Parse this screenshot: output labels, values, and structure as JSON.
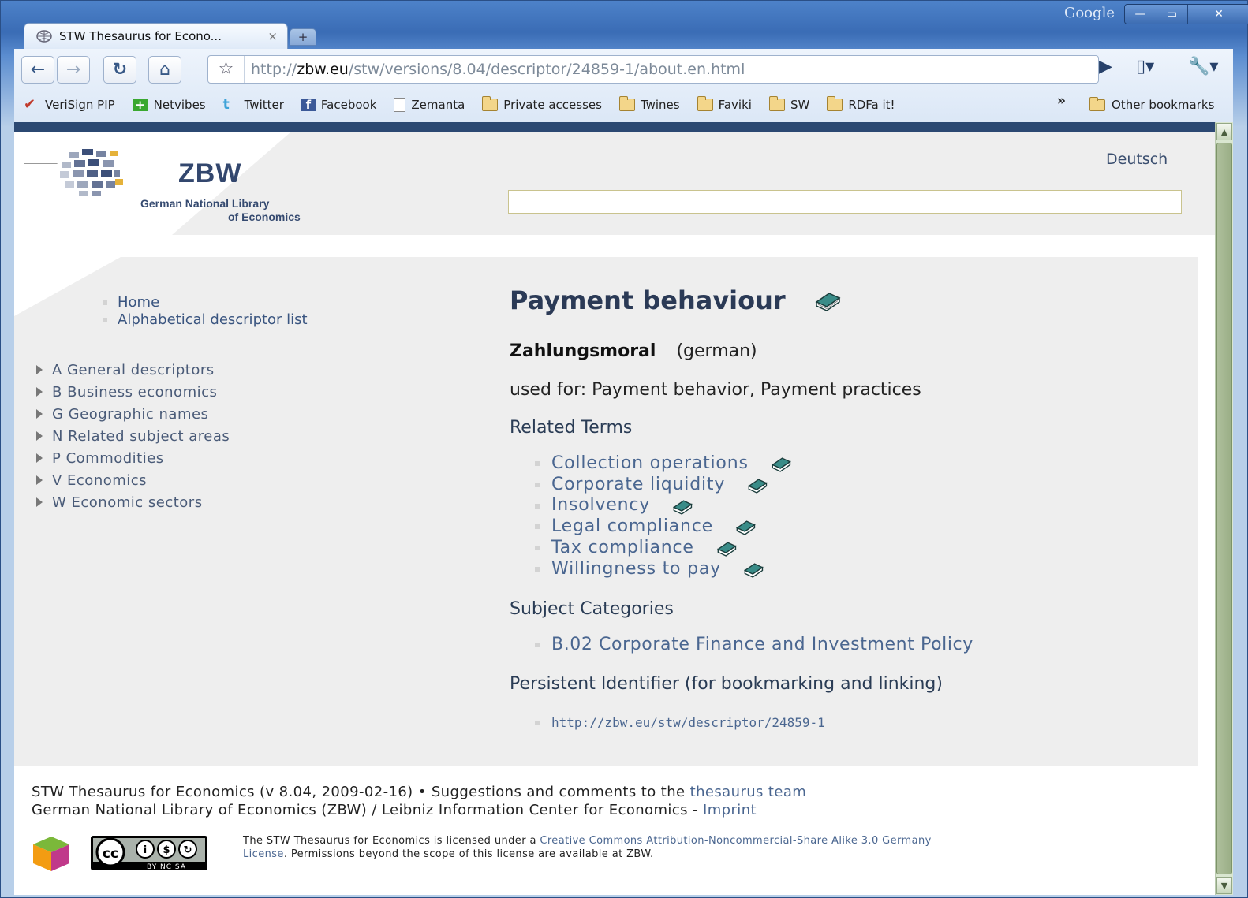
{
  "browser": {
    "brand": "Google",
    "tab_title": "STW Thesaurus for Econo...",
    "tab_close": "×",
    "new_tab": "+",
    "url_prefix": "http://",
    "url_host": "zbw.eu",
    "url_path": "/stw/versions/8.04/descriptor/24859-1/about.en.html",
    "bookmarks": [
      "VeriSign PIP",
      "Netvibes",
      "Twitter",
      "Facebook",
      "Zemanta",
      "Private accesses",
      "Twines",
      "Faviki",
      "SW",
      "RDFa it!"
    ],
    "overflow": "»",
    "other_bookmarks": "Other bookmarks"
  },
  "header": {
    "logo_title": "ZBW",
    "logo_sub1": "German National Library",
    "logo_sub2": "of Economics",
    "language_link": "Deutsch",
    "search_value": ""
  },
  "nav": {
    "links": [
      "Home",
      "Alphabetical descriptor list"
    ],
    "categories": [
      "A General descriptors",
      "B Business economics",
      "G Geographic names",
      "N Related subject areas",
      "P Commodities",
      "V Economics",
      "W Economic sectors"
    ]
  },
  "descriptor": {
    "title": "Payment behaviour",
    "preferred_german": "Zahlungsmoral",
    "language_note": "(german)",
    "used_for": "used for: Payment behavior, Payment practices",
    "related_heading": "Related Terms",
    "related": [
      "Collection operations",
      "Corporate liquidity",
      "Insolvency",
      "Legal compliance",
      "Tax compliance",
      "Willingness to pay"
    ],
    "subject_heading": "Subject Categories",
    "subject": "B.02 Corporate Finance and Investment Policy",
    "pid_heading": "Persistent Identifier (for bookmarking and linking)",
    "pid": "http://zbw.eu/stw/descriptor/24859-1"
  },
  "footer": {
    "line1_text": "STW Thesaurus for Economics (v 8.04, 2009-02-16)  •  Suggestions and comments to the ",
    "line1_link": "thesaurus team",
    "line2_text": "German National Library of Economics (ZBW) / Leibniz Information Center for Economics - ",
    "line2_link": "Imprint",
    "license_pre": "The STW Thesaurus for Economics is licensed under a ",
    "license_link1": "Creative Commons Attribution-Noncommercial-Share Alike 3.0 Germany",
    "license_link2": "License",
    "license_post": ". Permissions beyond the scope of this license are available at ZBW.",
    "cc_badge_text": "BY  NC  SA"
  },
  "colors": {
    "topbar": "#2b4872",
    "link": "#4a6690",
    "heading": "#2b3a56",
    "grey_panel": "#eeeeee"
  }
}
